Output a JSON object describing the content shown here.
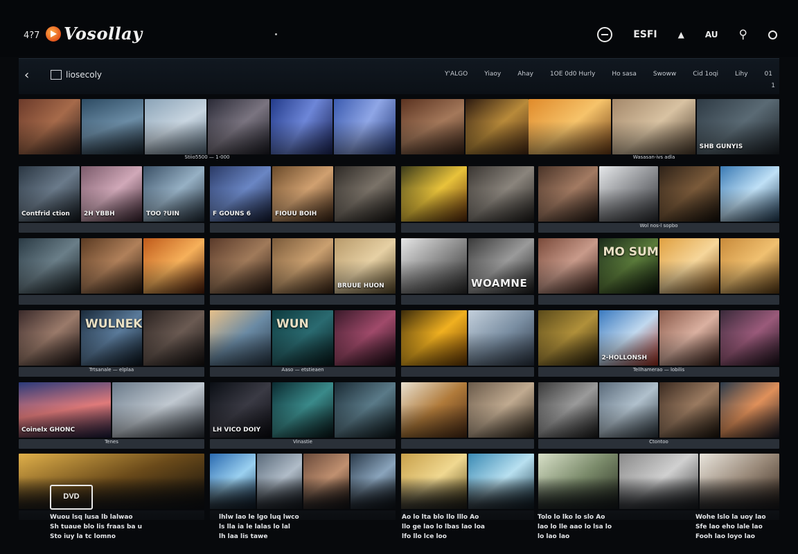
{
  "app": {
    "count": "4?7",
    "logo_text": "Vosollay",
    "top_labels": [
      "ESFI",
      "AU"
    ]
  },
  "nav": {
    "title": "liosecoly",
    "links": [
      "Y'ALGO",
      "Yiaoy",
      "Ahay",
      "1OE 0d0 Hurly",
      "Ho sasa",
      "Swoww",
      "Cid 1oqi",
      "Lihy",
      "01"
    ],
    "sub": "1"
  },
  "rows": [
    {
      "groups": [
        {
          "tiles": [
            {
              "grad": "linear-gradient(135deg,#6b3a2a,#a66a4a,#2a1e1c)"
            },
            {
              "grad": "linear-gradient(160deg,#2d4b63,#6b8ca5,#1a2630)"
            },
            {
              "grad": "linear-gradient(150deg,#8aa3b7,#c8d5e0,#55697a)"
            },
            {
              "grad": "linear-gradient(140deg,#2a2a36,#7a7480,#1c1c24)"
            },
            {
              "grad": "linear-gradient(120deg,#233b8a,#6d86d8,#1a2458)"
            },
            {
              "grad": "linear-gradient(120deg,#3b5bb0,#8fa6e6,#243a7a)"
            }
          ],
          "caption": "Stiio5500 — 1-000"
        },
        {
          "tiles": [
            {
              "grad": "linear-gradient(150deg,#5a3220,#a4785a,#3a2418)"
            },
            {
              "grad": "linear-gradient(140deg,#2c1a10,#b88a3a,#4a2a14)"
            }
          ],
          "caption": ""
        },
        {
          "tiles": [
            {
              "grad": "linear-gradient(140deg,#e08a2a,#f6c36a,#6a3a14)"
            },
            {
              "grad": "linear-gradient(140deg,#a4886a,#d8c2a2,#4a3a2a)"
            },
            {
              "grad": "linear-gradient(140deg,#2e3a44,#5a6a74,#1a2026)",
              "text": "SHB GUNYIS"
            }
          ],
          "caption": "Wasasan-ivs adla"
        }
      ]
    },
    {
      "groups": [
        {
          "tiles": [
            {
              "grad": "linear-gradient(140deg,#2a3642,#6a7a8a,#141a20)",
              "text": "Contfrid ction"
            },
            {
              "grad": "linear-gradient(140deg,#7a5a6a,#d0a8b8,#3a2430)",
              "text": "2H YBBH"
            },
            {
              "grad": "linear-gradient(140deg,#3a5066,#96b0c4,#1e2a36)",
              "text": "TOO ?UIN"
            }
          ],
          "caption": ""
        },
        {
          "tiles": [
            {
              "grad": "linear-gradient(140deg,#2a3a66,#6a86c4,#141c36)",
              "text": "F GOUNS 6"
            },
            {
              "grad": "linear-gradient(140deg,#6a4a2a,#d0a070,#3a2414)",
              "text": "FIOUU BOIH"
            },
            {
              "grad": "linear-gradient(140deg,#2e2a26,#7a7268,#161412)"
            }
          ],
          "caption": ""
        },
        {
          "tiles": [
            {
              "grad": "linear-gradient(140deg,#3a3a1a,#e8c23a,#5a2a0a)"
            },
            {
              "grad": "linear-gradient(140deg,#3a3632,#8a847c,#1e1c1a)"
            }
          ],
          "caption": ""
        },
        {
          "tiles": [
            {
              "grad": "linear-gradient(140deg,#4a3428,#a27a62,#261a14)"
            },
            {
              "grad": "linear-gradient(140deg,#e6e8ea,#8a8c90,#2a2c30)"
            },
            {
              "grad": "linear-gradient(140deg,#2e2218,#7a5a3a,#16100a)"
            },
            {
              "grad": "linear-gradient(140deg,#3a7ab4,#bfe0f6,#1e3a54)"
            }
          ],
          "caption": "Wol nos-l sopbo"
        }
      ]
    },
    {
      "groups": [
        {
          "tiles": [
            {
              "grad": "linear-gradient(140deg,#2a3a44,#6a7e88,#141c20)"
            },
            {
              "grad": "linear-gradient(140deg,#5a3a22,#b0805a,#2a1a0e)"
            },
            {
              "grad": "linear-gradient(140deg,#c05a1a,#f6b05a,#4a1a08)"
            }
          ],
          "caption": ""
        },
        {
          "tiles": [
            {
              "grad": "linear-gradient(140deg,#5a3a2a,#a07a5a,#2a1a12)"
            },
            {
              "grad": "linear-gradient(140deg,#7a5a3a,#caa070,#3a2414)"
            },
            {
              "grad": "linear-gradient(140deg,#b89a6a,#e6d0a4,#5a4a2a)",
              "text": "BRUUE HUON"
            }
          ],
          "caption": ""
        },
        {
          "tiles": [
            {
              "grad": "linear-gradient(140deg,#e6e6e6,#8a8a8a,#2a2a2a)"
            },
            {
              "grad": "linear-gradient(140deg,#3a3a3a,#9a9a9a,#1a1a1a)",
              "text": "WOAMNE",
              "big": true
            }
          ],
          "caption": ""
        },
        {
          "tiles": [
            {
              "grad": "linear-gradient(140deg,#7a4a3a,#c89a8a,#3a2018)"
            },
            {
              "grad": "linear-gradient(140deg,#1a2a1a,#5a7a3a,#0a140a)",
              "text": "MO SUME OPATA",
              "mid": true
            },
            {
              "grad": "linear-gradient(140deg,#e0a040,#f6d69a,#7a4a14)"
            },
            {
              "grad": "linear-gradient(140deg,#c88a3a,#f0c070,#5a3a14)"
            }
          ],
          "caption": ""
        }
      ]
    },
    {
      "groups": [
        {
          "tiles": [
            {
              "grad": "linear-gradient(140deg,#3a2a2a,#9a7a6a,#1a1212)"
            },
            {
              "grad": "linear-gradient(140deg,#1a2a3a,#5a7a9a,#0a141e)",
              "text": "WULNEK",
              "mid": true
            },
            {
              "grad": "linear-gradient(140deg,#2a2220,#6a5a52,#141010)"
            }
          ],
          "caption": "Trtsanale — elplaa"
        },
        {
          "tiles": [
            {
              "grad": "linear-gradient(140deg,#e6c08a,#6a8aa4,#2a3a4a)"
            },
            {
              "grad": "linear-gradient(140deg,#0e3a3e,#2a6a70,#061a1c)",
              "text": "WUN",
              "mid": true
            },
            {
              "grad": "linear-gradient(140deg,#3a1a2a,#a04a6a,#1a0a14)"
            }
          ],
          "caption": "Aaso — etstieaen"
        },
        {
          "tiles": [
            {
              "grad": "linear-gradient(140deg,#3a2a0a,#f0b020,#6a3a04)"
            },
            {
              "grad": "linear-gradient(140deg,#c4d0dc,#7a8ea2,#2a3442)"
            }
          ],
          "caption": ""
        },
        {
          "tiles": [
            {
              "grad": "linear-gradient(140deg,#5a4a1a,#b0903a,#2a200a)"
            },
            {
              "grad": "linear-gradient(140deg,#3a7ac0,#c0d8ee,#a02a1a)",
              "text": "2-HOLLONSH"
            },
            {
              "grad": "linear-gradient(140deg,#8a5a4a,#dab0a0,#3a2018)"
            },
            {
              "grad": "linear-gradient(140deg,#3a2a3a,#9a5a7a,#1a101a)"
            }
          ],
          "caption": "Tellhamerao — lobilis"
        }
      ]
    },
    {
      "groups": [
        {
          "tiles": [
            {
              "grad": "linear-gradient(170deg,#2a3a7a,#e07a7a,#1a1a3a)",
              "text": "Coinelx GHONC"
            },
            {
              "grad": "linear-gradient(150deg,#6a7a8a,#c0c8d0,#2a3038)"
            }
          ],
          "caption": "Tenes"
        },
        {
          "tiles": [
            {
              "grad": "linear-gradient(140deg,#0a0e14,#3a3a44,#0a0a10)",
              "text": "LH VICO DOIY"
            },
            {
              "grad": "linear-gradient(140deg,#0a2a30,#3a8a8a,#061416)"
            },
            {
              "grad": "linear-gradient(140deg,#1a2a34,#5a7a88,#0a1418)"
            }
          ],
          "caption": "Vinastie"
        },
        {
          "tiles": [
            {
              "grad": "linear-gradient(140deg,#e8e0d0,#b07a3a,#4a2a14)"
            },
            {
              "grad": "linear-gradient(140deg,#6a5a4a,#c0aa90,#2a2218)"
            }
          ],
          "caption": ""
        },
        {
          "tiles": [
            {
              "grad": "linear-gradient(140deg,#3a3a3a,#9a9a9a,#1a1a1a)"
            },
            {
              "grad": "linear-gradient(140deg,#5a6a7a,#b0c0cc,#2a343c)"
            },
            {
              "grad": "linear-gradient(140deg,#3a2a20,#9a7a60,#1a120a)"
            },
            {
              "grad": "linear-gradient(140deg,#2a3a4a,#e0905a,#1a1a24)"
            }
          ],
          "caption": "Ctontoo"
        }
      ]
    },
    {
      "groups": [
        {
          "tiles": [
            {
              "grad": "linear-gradient(160deg,#e0b04a,#6a4a1a,#0a0a0a)"
            }
          ],
          "caption": ""
        },
        {
          "tiles": [
            {
              "grad": "linear-gradient(140deg,#2a6ab0,#9ad0f0,#1a3a5a)"
            },
            {
              "grad": "linear-gradient(140deg,#5a6a7a,#b0bcc8,#2a3038)"
            },
            {
              "grad": "linear-gradient(140deg,#6a4a3a,#c09070,#2a1a12)"
            },
            {
              "grad": "linear-gradient(140deg,#2a3a4a,#8aa4bc,#121a22)"
            }
          ],
          "caption": ""
        },
        {
          "tiles": [
            {
              "grad": "linear-gradient(140deg,#c8a04a,#f0d890,#5a4a1a)"
            },
            {
              "grad": "linear-gradient(140deg,#3a8ab4,#b8e0f0,#1a3a4a)"
            }
          ],
          "caption": ""
        },
        {
          "tiles": [
            {
              "grad": "linear-gradient(140deg,#d8e0c8,#7a8a6a,#2a3022)"
            },
            {
              "grad": "linear-gradient(140deg,#8a8a8a,#d0d0d0,#3a3a3a)"
            },
            {
              "grad": "linear-gradient(140deg,#e8e4dc,#9a8a7a,#3a2a1e)"
            }
          ],
          "caption": ""
        }
      ]
    }
  ],
  "bottom": {
    "dvd_label": "DVD",
    "cols": [
      {
        "lines": [
          "Wuou lsq lusa lb lalwao",
          "Sh tuaue blo lis fraas ba u",
          "Sto iuy la tc lomno"
        ]
      },
      {
        "lines": [
          "lhlw lao le lgo luq lwco",
          "ls lla ia le lalas lo lal",
          "lh laa lis tawe"
        ]
      },
      {
        "lines": [
          "Ao lo lta blo llo lllo Ao",
          "llo ge lao lo lbas lao loa",
          "lfo llo lce loo"
        ]
      },
      {
        "lines": [
          "Tolo lo lko lo slo Ao",
          "lao lo lle aao lo lsa lo",
          "lo lao lao"
        ]
      },
      {
        "lines": [
          "Wohe lslo la uoy lao",
          "Sfe lao eho lale lao",
          "Fooh lao loyo lao"
        ]
      }
    ]
  }
}
